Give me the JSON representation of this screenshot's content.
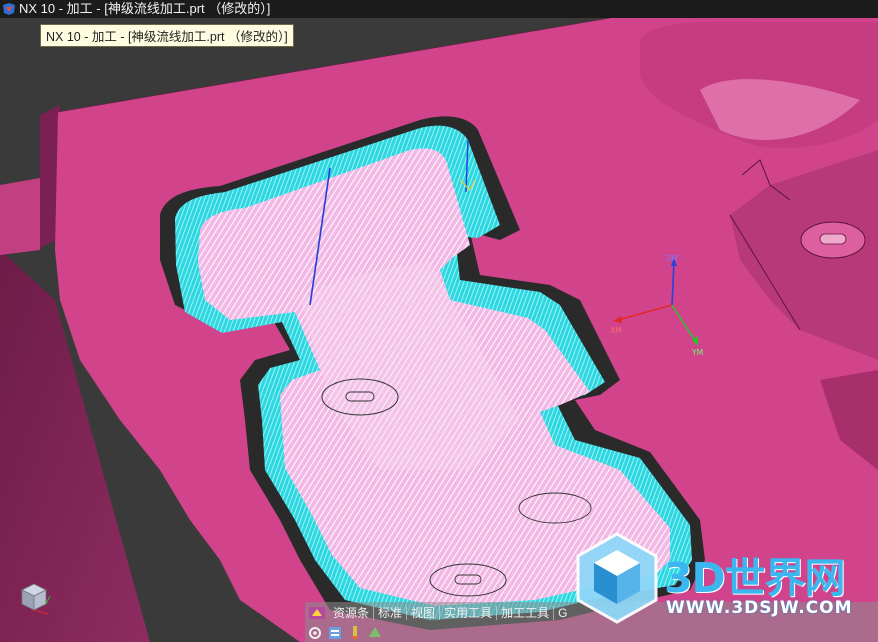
{
  "window": {
    "title": "NX 10 - 加工 - [神级流线加工.prt （修改的）]",
    "tooltip": "NX 10 - 加工 - [神级流线加工.prt （修改的）]"
  },
  "triad": {
    "z_label": "ZM",
    "x_label": "XM",
    "y_label": "YM"
  },
  "watermark": {
    "title": "3D世界网",
    "url": "WWW.3DSJW.COM"
  },
  "resource_bar": {
    "tabs": [
      {
        "label": "资源条"
      },
      {
        "label": "标准"
      },
      {
        "label": "视图"
      },
      {
        "label": "实用工具"
      },
      {
        "label": "加工工具"
      },
      {
        "label": "G"
      }
    ]
  },
  "colors": {
    "part": "#d1448c",
    "part_wall": "#7a1f50",
    "toolpath": "#3fe6e6",
    "wm_blue": "#3bb6ef"
  },
  "icons": [
    "app-icon",
    "gear-icon",
    "view-cube-icon"
  ]
}
